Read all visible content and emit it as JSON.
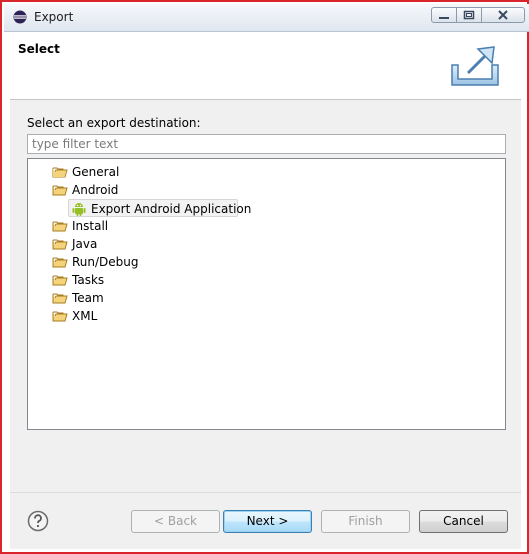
{
  "window": {
    "title": "Export"
  },
  "header": {
    "title": "Select",
    "icon": "export-wizard-icon"
  },
  "body": {
    "prompt": "Select an export destination:",
    "filter": {
      "value": "",
      "placeholder": "type filter text"
    },
    "tree": {
      "items": [
        {
          "label": "General",
          "icon": "folder-icon",
          "level": 0
        },
        {
          "label": "Android",
          "icon": "folder-open-icon",
          "level": 0,
          "expanded": true
        },
        {
          "label": "Export Android Application",
          "icon": "android-icon",
          "level": 1,
          "selected": true
        },
        {
          "label": "Install",
          "icon": "folder-icon",
          "level": 0
        },
        {
          "label": "Java",
          "icon": "folder-icon",
          "level": 0
        },
        {
          "label": "Run/Debug",
          "icon": "folder-icon",
          "level": 0
        },
        {
          "label": "Tasks",
          "icon": "folder-icon",
          "level": 0
        },
        {
          "label": "Team",
          "icon": "folder-icon",
          "level": 0
        },
        {
          "label": "XML",
          "icon": "folder-icon",
          "level": 0
        }
      ]
    }
  },
  "footer": {
    "back_label": "< Back",
    "next_label": "Next >",
    "finish_label": "Finish",
    "cancel_label": "Cancel"
  },
  "colors": {
    "outline": "#d9262c",
    "android_green": "#97c024",
    "folder_yellow": "#f5d37a"
  }
}
